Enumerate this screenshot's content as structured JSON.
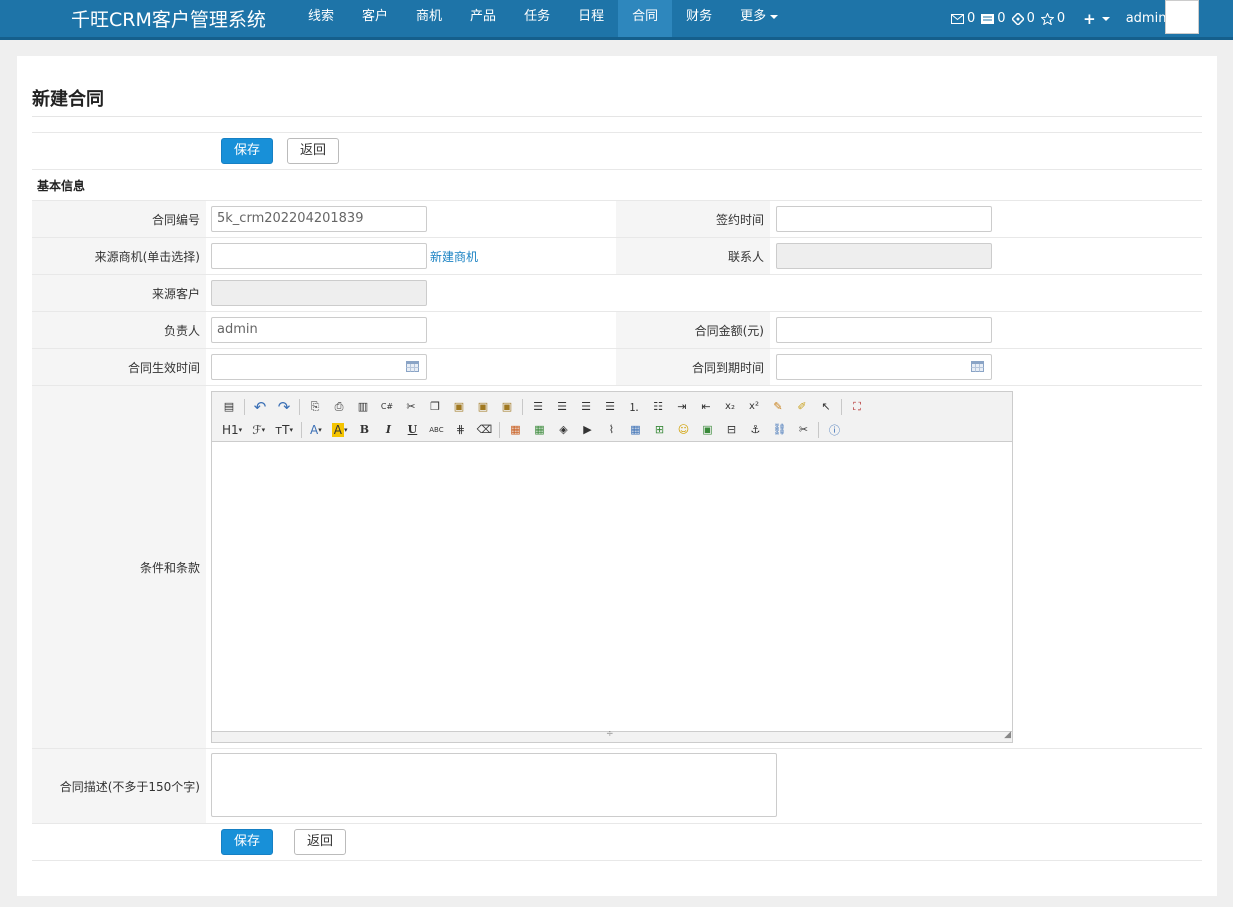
{
  "app": {
    "brand": "千旺CRM客户管理系统"
  },
  "nav": {
    "items": [
      {
        "label": "线索",
        "active": false
      },
      {
        "label": "客户",
        "active": false
      },
      {
        "label": "商机",
        "active": false
      },
      {
        "label": "产品",
        "active": false
      },
      {
        "label": "任务",
        "active": false
      },
      {
        "label": "日程",
        "active": false
      },
      {
        "label": "合同",
        "active": true
      },
      {
        "label": "财务",
        "active": false
      }
    ],
    "more": "更多",
    "stats": [
      "0",
      "0",
      "0",
      "0"
    ],
    "plus": "+",
    "user": "admin"
  },
  "page": {
    "title": "新建合同"
  },
  "buttons": {
    "save": "保存",
    "back": "返回"
  },
  "section": {
    "basic": "基本信息"
  },
  "form": {
    "contract_no": {
      "label": "合同编号",
      "value": "5k_crm202204201839"
    },
    "sign_time": {
      "label": "签约时间",
      "value": ""
    },
    "source_opportunity": {
      "label": "来源商机(单击选择)",
      "value": "",
      "link": "新建商机"
    },
    "contact": {
      "label": "联系人",
      "value": ""
    },
    "source_customer": {
      "label": "来源客户",
      "value": ""
    },
    "owner": {
      "label": "负责人",
      "value": "admin"
    },
    "amount": {
      "label": "合同金额(元)",
      "value": ""
    },
    "start_time": {
      "label": "合同生效时间",
      "value": ""
    },
    "end_time": {
      "label": "合同到期时间",
      "value": ""
    },
    "terms": {
      "label": "条件和条款"
    },
    "description": {
      "label": "合同描述(不多于150个字)",
      "value": ""
    }
  },
  "editor": {
    "heading": "H1",
    "font": "ℱ",
    "size": "тT",
    "font_color": "A",
    "bg_color": "A",
    "bold": "B",
    "italic": "I",
    "underline": "U",
    "strike": "ABC"
  },
  "colors": {
    "navbar": "#1e74a8",
    "primary": "#1890d8",
    "link": "#1a82c3"
  }
}
